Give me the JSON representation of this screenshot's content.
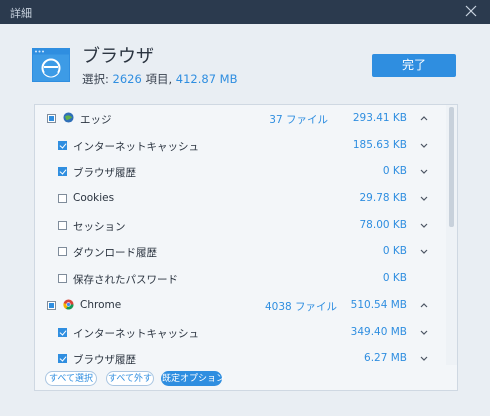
{
  "window": {
    "title": "詳細"
  },
  "header": {
    "title": "ブラウザ",
    "selection_label": "選択: ",
    "item_count": "2626",
    "items_label": " 項目, ",
    "total_size": "412.87 MB",
    "done_button": "完了"
  },
  "rows": [
    {
      "kind": "group",
      "state": "partial",
      "icon": "edge-globe-icon",
      "label": "エッジ",
      "count": "37 ファイル",
      "size": "293.41 KB",
      "chevron": "up"
    },
    {
      "kind": "child",
      "state": "checked",
      "label": "インターネットキャッシュ",
      "count": "",
      "size": "185.63 KB",
      "chevron": "down"
    },
    {
      "kind": "child",
      "state": "checked",
      "label": "ブラウザ履歴",
      "count": "",
      "size": "0 KB",
      "chevron": "down"
    },
    {
      "kind": "child",
      "state": "unchecked",
      "label": "Cookies",
      "count": "",
      "size": "29.78 KB",
      "chevron": "down"
    },
    {
      "kind": "child",
      "state": "unchecked",
      "label": "セッション",
      "count": "",
      "size": "78.00 KB",
      "chevron": "down"
    },
    {
      "kind": "child",
      "state": "unchecked",
      "label": "ダウンロード履歴",
      "count": "",
      "size": "0 KB",
      "chevron": "down"
    },
    {
      "kind": "child",
      "state": "unchecked",
      "label": "保存されたパスワード",
      "count": "",
      "size": "0 KB",
      "chevron": ""
    },
    {
      "kind": "group",
      "state": "partial",
      "icon": "chrome-icon",
      "label": "Chrome",
      "count": "4038 ファイル",
      "size": "510.54 MB",
      "chevron": "up"
    },
    {
      "kind": "child",
      "state": "checked",
      "label": "インターネットキャッシュ",
      "count": "",
      "size": "349.40 MB",
      "chevron": "down"
    },
    {
      "kind": "child",
      "state": "checked",
      "label": "ブラウザ履歴",
      "count": "",
      "size": "6.27 MB",
      "chevron": "down"
    }
  ],
  "footer": {
    "select_all": "すべて選択",
    "deselect_all": "すべて外す",
    "default_options": "既定オプション"
  },
  "colors": {
    "accent": "#2f8ee0",
    "titlebar": "#2b3a4e",
    "background": "#e9eef3"
  }
}
